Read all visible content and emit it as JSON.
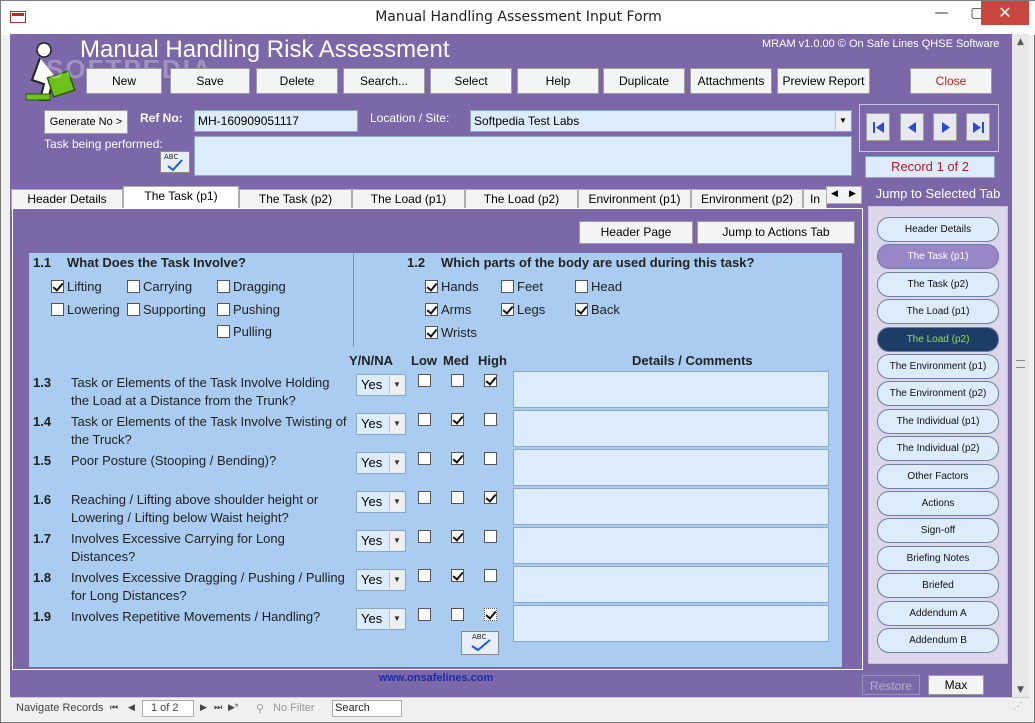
{
  "window": {
    "title": "Manual Handling Assessment Input Form",
    "minimize": "—",
    "maximize": "▢",
    "close": "✕"
  },
  "header": {
    "app_title": "Manual Handling Risk Assessment",
    "watermark": "SOFTPEDIA",
    "version": "MRAM v1.0.00 © On Safe Lines QHSE Software"
  },
  "toolbar": {
    "new": "New",
    "save": "Save",
    "delete": "Delete",
    "search": "Search...",
    "select": "Select",
    "help": "Help",
    "duplicate": "Duplicate",
    "attachments": "Attachments",
    "preview": "Preview Report",
    "close": "Close"
  },
  "record_fields": {
    "generate_label": "Generate No >",
    "ref_label": "Ref No:",
    "ref_value": "MH-160909051117",
    "location_label": "Location / Site:",
    "location_value": "Softpedia Test Labs",
    "task_label": "Task being performed:",
    "task_value": "",
    "spell_icon_text": "ABC"
  },
  "navigation": {
    "record": "Record 1 of 2",
    "first": "⏮",
    "prev": "◀",
    "next": "▶",
    "last": "⏭"
  },
  "tabs": [
    "Header Details",
    "The Task (p1)",
    "The Task (p2)",
    "The Load (p1)",
    "The Load (p2)",
    "Environment (p1)",
    "Environment (p2)",
    "In"
  ],
  "active_tab": "The Task (p1)",
  "tab_scroll": {
    "left": "◀",
    "right": "▶"
  },
  "panel": {
    "header_page": "Header Page",
    "jump_actions": "Jump to Actions Tab"
  },
  "section_1_1": {
    "num": "1.1",
    "title": "What Does the Task Involve?",
    "options": [
      {
        "label": "Lifting",
        "checked": true
      },
      {
        "label": "Carrying",
        "checked": false
      },
      {
        "label": "Dragging",
        "checked": false
      },
      {
        "label": "Lowering",
        "checked": false
      },
      {
        "label": "Supporting",
        "checked": false
      },
      {
        "label": "Pushing",
        "checked": false
      },
      {
        "label": "Pulling",
        "checked": false
      }
    ]
  },
  "section_1_2": {
    "num": "1.2",
    "title": "Which parts of the body are used during this task?",
    "options": [
      {
        "label": "Hands",
        "checked": true
      },
      {
        "label": "Feet",
        "checked": false
      },
      {
        "label": "Head",
        "checked": false
      },
      {
        "label": "Arms",
        "checked": true
      },
      {
        "label": "Legs",
        "checked": true
      },
      {
        "label": "Back",
        "checked": true
      },
      {
        "label": "Wrists",
        "checked": true
      }
    ]
  },
  "columns": {
    "ynna": "Y/N/NA",
    "low": "Low",
    "med": "Med",
    "high": "High",
    "details": "Details / Comments"
  },
  "questions": [
    {
      "num": "1.3",
      "text": "Task or Elements of the Task Involve Holding the Load at a Distance from the Trunk?",
      "answer": "Yes",
      "rating": "high"
    },
    {
      "num": "1.4",
      "text": "Task or Elements of the Task Involve Twisting of the Truck?",
      "answer": "Yes",
      "rating": "med"
    },
    {
      "num": "1.5",
      "text": "Poor Posture (Stooping / Bending)?",
      "answer": "Yes",
      "rating": "med"
    },
    {
      "num": "1.6",
      "text": "Reaching / Lifting above shoulder height or Lowering / Lifting below Waist height?",
      "answer": "Yes",
      "rating": "high"
    },
    {
      "num": "1.7",
      "text": "Involves Excessive Carrying for Long Distances?",
      "answer": "Yes",
      "rating": "med"
    },
    {
      "num": "1.8",
      "text": "Involves Excessive Dragging / Pushing / Pulling for Long Distances?",
      "answer": "Yes",
      "rating": "med"
    },
    {
      "num": "1.9",
      "text": "Involves Repetitive Movements / Handling?",
      "answer": "Yes",
      "rating": "high"
    }
  ],
  "website": "www.onsafelines.com",
  "jump": {
    "title": "Jump to Selected Tab",
    "items": [
      "Header Details",
      "The Task (p1)",
      "The Task (p2)",
      "The Load (p1)",
      "The Load (p2)",
      "The Environment (p1)",
      "The Environment (p2)",
      "The Individual (p1)",
      "The Individual (p2)",
      "Other Factors",
      "Actions",
      "Sign-off",
      "Briefing Notes",
      "Briefed",
      "Addendum A",
      "Addendum B"
    ],
    "current": "The Task (p1)",
    "highlighted": "The Load (p2)"
  },
  "bottom": {
    "restore": "Restore",
    "max": "Max"
  },
  "statusbar": {
    "navigate": "Navigate Records",
    "rec_first": "⏮",
    "rec_prev": "◀",
    "record": "1 of 2",
    "rec_next": "▶",
    "rec_last": "⏭",
    "rec_new": "▶*",
    "filter": "No Filter",
    "search": "Search"
  },
  "colors": {
    "form_bg": "#7c67a8",
    "field_bg": "#dcecfb",
    "inner_bg": "#a9ccf0",
    "record_red": "#b02020",
    "link_blue": "#1a2ea8"
  }
}
